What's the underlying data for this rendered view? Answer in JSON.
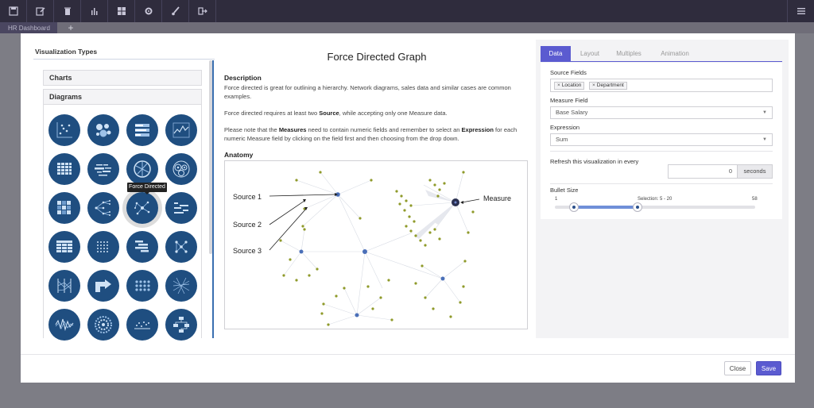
{
  "toolbar": {
    "icons": [
      "save-icon",
      "edit-icon",
      "trash-icon",
      "bar-chart-icon",
      "grid-icon",
      "gear-icon",
      "brush-icon",
      "sign-out-icon"
    ],
    "right_icon": "hamburger-icon"
  },
  "dashboard": {
    "tab_label": "HR Dashboard",
    "add_label": "+"
  },
  "left_panel": {
    "title": "Visualization Types",
    "sections": {
      "charts": "Charts",
      "diagrams": "Diagrams"
    },
    "tooltip": "Force Directed",
    "selected": "Force Directed"
  },
  "middle_panel": {
    "title": "Force Directed Graph",
    "description_heading": "Description",
    "description_1": "Force directed is great for outlining a hierarchy. Network diagrams, sales data and similar cases are common examples.",
    "description_2_pre": "Force directed requires at least two ",
    "description_2_b1": "Source",
    "description_2_post": ", while accepting only one Measure data.",
    "description_3_pre": "Please note that the ",
    "description_3_b1": "Measures",
    "description_3_mid": " need to contain numeric fields and remember to select an ",
    "description_3_b2": "Expression",
    "description_3_post": " for each numeric Measure field by clicking on the field first and then choosing from the drop down.",
    "anatomy_heading": "Anatomy",
    "anatomy_labels": {
      "source1": "Source 1",
      "source2": "Source 2",
      "source3": "Source 3",
      "measure": "Measure"
    }
  },
  "right_panel": {
    "tabs": [
      "Data",
      "Layout",
      "Multiples",
      "Animation"
    ],
    "active_tab": "Data",
    "source_fields_label": "Source Fields",
    "source_fields": [
      "Location",
      "Department"
    ],
    "chip_remove": "×",
    "measure_field_label": "Measure Field",
    "measure_field_value": "Base Salary",
    "expression_label": "Expression",
    "expression_value": "Sum",
    "refresh_label": "Refresh this visualization in every",
    "refresh_value": "0",
    "refresh_unit": "seconds",
    "bullet_size_label": "Bullet Size",
    "bullet_min": "1",
    "bullet_max": "58",
    "bullet_selection": "Selection: 5 - 20",
    "bullet_range": [
      5,
      20
    ],
    "caret": "▼"
  },
  "footer": {
    "close_label": "Close",
    "save_label": "Save"
  },
  "colors": {
    "accent": "#5b5bd0",
    "icon_bg": "#1f4e80",
    "toolbar": "#2f2c3d"
  }
}
